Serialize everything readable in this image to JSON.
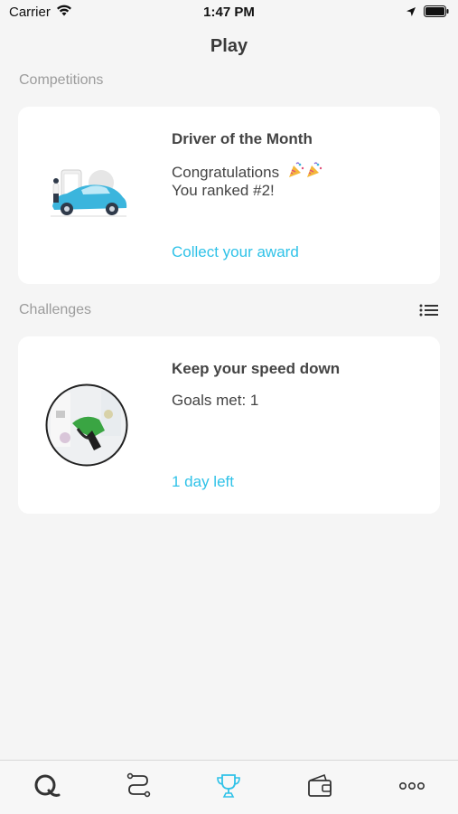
{
  "status_bar": {
    "carrier": "Carrier",
    "time": "1:47 PM",
    "icons": [
      "wifi-icon",
      "location-arrow-icon",
      "battery-icon"
    ]
  },
  "header": {
    "title": "Play"
  },
  "competitions": {
    "section_label": "Competitions",
    "card": {
      "title": "Driver of the Month",
      "line1": "Congratulations",
      "celebration_icons": [
        "party-popper-icon",
        "party-popper-icon"
      ],
      "line2": "You ranked #2!",
      "link": "Collect your award",
      "illustration": "car-driver-illustration"
    }
  },
  "challenges": {
    "section_label": "Challenges",
    "list_icon": "list-icon",
    "card": {
      "title": "Keep your speed down",
      "goals": "Goals met: 1",
      "link": "1 day left",
      "image": "fuel-nozzle-photo"
    }
  },
  "tab_bar": {
    "tabs": [
      {
        "name": "home",
        "icon": "q-logo-icon",
        "active": false
      },
      {
        "name": "trips",
        "icon": "route-icon",
        "active": false
      },
      {
        "name": "play",
        "icon": "trophy-icon",
        "active": true
      },
      {
        "name": "wallet",
        "icon": "wallet-icon",
        "active": false
      },
      {
        "name": "more",
        "icon": "more-dots-icon",
        "active": false
      }
    ]
  },
  "colors": {
    "accent": "#2fc2e8",
    "background": "#f5f5f5",
    "card": "#ffffff",
    "muted_text": "#9c9c9c"
  }
}
